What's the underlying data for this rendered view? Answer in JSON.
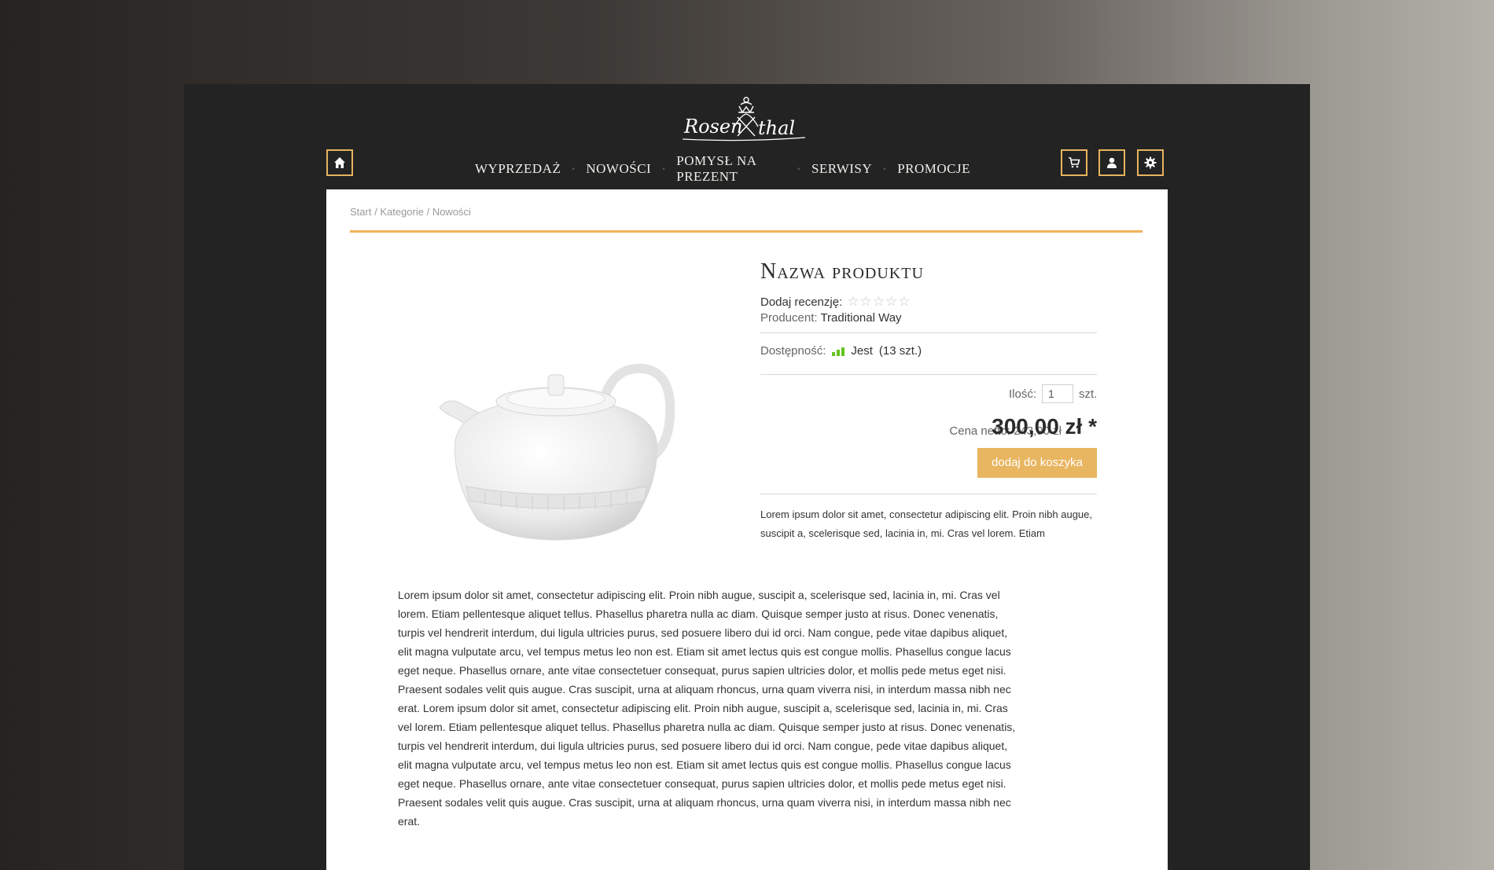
{
  "brand": {
    "logo_text": "Rosenthal"
  },
  "nav": {
    "items": [
      "WYPRZEDAŻ",
      "NOWOŚCI",
      "POMYSŁ NA PREZENT",
      "SERWISY",
      "PROMOCJE"
    ],
    "separator": "◦"
  },
  "icons": {
    "home": "home-icon",
    "cart": "cart-icon",
    "account": "user-icon",
    "settings": "gear-icon"
  },
  "breadcrumb": {
    "items": [
      "Start",
      "Kategorie",
      "Nowości"
    ],
    "separator": " / "
  },
  "product": {
    "title": "Nazwa produktu",
    "review_label": "Dodaj recenzję:",
    "stars": "☆☆☆☆☆",
    "producer_label": "Producent:",
    "producer": "Traditional Way",
    "availability_label": "Dostępność:",
    "availability_value": "Jest",
    "availability_count": "(13 szt.)",
    "quantity_label": "Ilość:",
    "quantity_value": "1",
    "quantity_unit": "szt.",
    "net_price": "Cena netto: 243,90 zł",
    "price": "300,00 zł *",
    "add_to_cart": "dodaj do koszyka",
    "short_description": "Lorem ipsum dolor sit amet, consectetur adipiscing elit. Proin nibh augue, suscipit a, scelerisque sed, lacinia in, mi. Cras vel lorem. Etiam",
    "long_description": "Lorem ipsum dolor sit amet, consectetur adipiscing elit. Proin nibh augue, suscipit a, scelerisque sed, lacinia in, mi. Cras vel lorem. Etiam pellentesque aliquet tellus. Phasellus pharetra nulla ac diam. Quisque semper justo at risus. Donec venenatis, turpis vel hendrerit interdum, dui ligula ultricies purus, sed posuere libero dui id orci. Nam congue, pede vitae dapibus aliquet, elit magna vulputate arcu, vel tempus metus leo non est. Etiam sit amet lectus quis est congue mollis. Phasellus congue lacus eget neque. Phasellus ornare, ante vitae consectetuer consequat, purus sapien ultricies dolor, et mollis pede metus eget nisi. Praesent sodales velit quis augue. Cras suscipit, urna at aliquam rhoncus, urna quam viverra nisi, in interdum massa nibh nec erat. Lorem ipsum dolor sit amet, consectetur adipiscing elit. Proin nibh augue, suscipit a, scelerisque sed, lacinia in, mi. Cras vel lorem. Etiam pellentesque aliquet tellus. Phasellus pharetra nulla ac diam. Quisque semper justo at risus. Donec venenatis, turpis vel hendrerit interdum, dui ligula ultricies purus, sed posuere libero dui id orci. Nam congue, pede vitae dapibus aliquet, elit magna vulputate arcu, vel tempus metus leo non est. Etiam sit amet lectus quis est congue mollis. Phasellus congue lacus eget neque. Phasellus ornare, ante vitae consectetuer consequat, purus sapien ultricies dolor, et mollis pede metus eget nisi. Praesent sodales velit quis augue. Cras suscipit, urna at aliquam rhoncus, urna quam viverra nisi, in interdum massa nibh nec erat."
  },
  "colors": {
    "accent": "#e8b560",
    "frame": "#232323",
    "panel": "#ffffff",
    "stock": "#64c31d"
  }
}
